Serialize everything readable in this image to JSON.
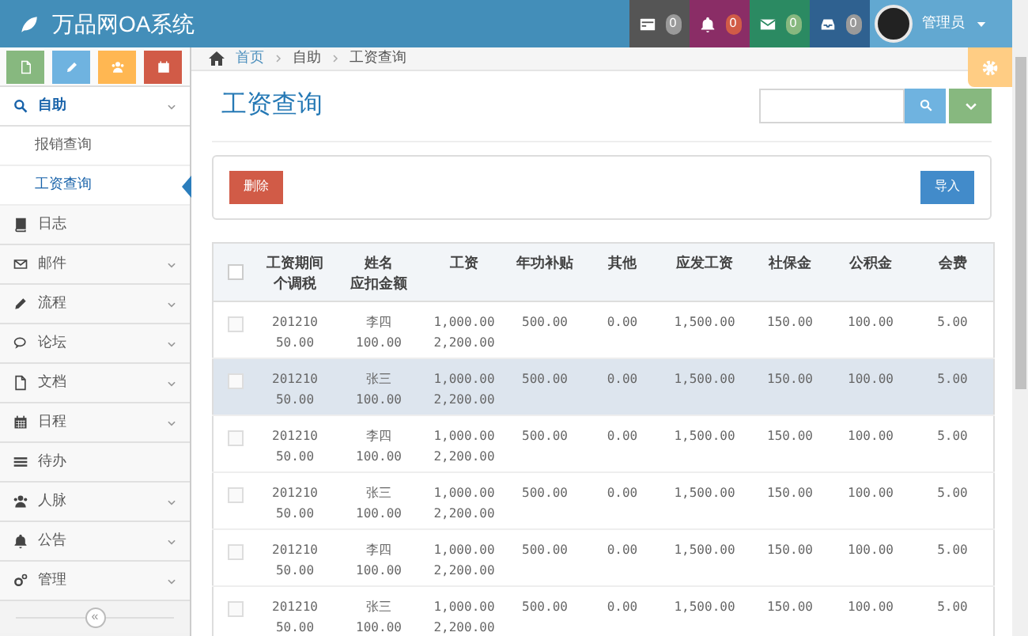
{
  "app_title": "万品网OA系统",
  "nav_badges": [
    {
      "count": "0",
      "color": "#555555"
    },
    {
      "count": "0",
      "color": "#8a2d66"
    },
    {
      "count": "0",
      "color": "#2b8a62"
    },
    {
      "count": "0",
      "color": "#2f6190"
    }
  ],
  "user": {
    "name": "管理员"
  },
  "shortcuts": [
    {
      "color": "#87b87f"
    },
    {
      "color": "#6fb3e0"
    },
    {
      "color": "#ffb752"
    },
    {
      "color": "#d15b47"
    }
  ],
  "breadcrumb": [
    "首页",
    "自助",
    "工资查询"
  ],
  "sidebar": {
    "items": [
      {
        "label": "自助",
        "has_submenu": true,
        "expanded": true,
        "children": [
          {
            "label": "报销查询",
            "selected": false
          },
          {
            "label": "工资查询",
            "selected": true
          }
        ]
      },
      {
        "label": "日志",
        "has_submenu": false,
        "expanded": false
      },
      {
        "label": "邮件",
        "has_submenu": true,
        "expanded": false
      },
      {
        "label": "流程",
        "has_submenu": true,
        "expanded": false
      },
      {
        "label": "论坛",
        "has_submenu": true,
        "expanded": false
      },
      {
        "label": "文档",
        "has_submenu": true,
        "expanded": false
      },
      {
        "label": "日程",
        "has_submenu": true,
        "expanded": false
      },
      {
        "label": "待办",
        "has_submenu": false,
        "expanded": false
      },
      {
        "label": "人脉",
        "has_submenu": true,
        "expanded": false
      },
      {
        "label": "公告",
        "has_submenu": true,
        "expanded": false
      },
      {
        "label": "管理",
        "has_submenu": true,
        "expanded": false
      }
    ],
    "collapse_button": "«"
  },
  "page_title": "工资查询",
  "toolbar": {
    "delete_button": "删除",
    "import_button": "导入"
  },
  "table": {
    "select_all_checked": false,
    "columns": [
      {
        "label": "工资期间",
        "sublabel": "个调税"
      },
      {
        "label": "姓名",
        "sublabel": "应扣金额"
      },
      {
        "label": "工资"
      },
      {
        "label": "年功补贴"
      },
      {
        "label": "其他"
      },
      {
        "label": "应发工资"
      },
      {
        "label": "社保金"
      },
      {
        "label": "公积金"
      },
      {
        "label": "会费"
      }
    ],
    "rows": [
      {
        "checked": false,
        "highlighted": false,
        "cells": [
          "201210\n50.00",
          "李四\n100.00",
          "1,000.00\n2,200.00",
          "500.00",
          "0.00",
          "1,500.00",
          "150.00",
          "100.00",
          "5.00"
        ]
      },
      {
        "checked": false,
        "highlighted": true,
        "cells": [
          "201210\n50.00",
          "张三\n100.00",
          "1,000.00\n2,200.00",
          "500.00",
          "0.00",
          "1,500.00",
          "150.00",
          "100.00",
          "5.00"
        ]
      },
      {
        "checked": false,
        "highlighted": false,
        "cells": [
          "201210\n50.00",
          "李四\n100.00",
          "1,000.00\n2,200.00",
          "500.00",
          "0.00",
          "1,500.00",
          "150.00",
          "100.00",
          "5.00"
        ]
      },
      {
        "checked": false,
        "highlighted": false,
        "cells": [
          "201210\n50.00",
          "张三\n100.00",
          "1,000.00\n2,200.00",
          "500.00",
          "0.00",
          "1,500.00",
          "150.00",
          "100.00",
          "5.00"
        ]
      },
      {
        "checked": false,
        "highlighted": false,
        "cells": [
          "201210\n50.00",
          "李四\n100.00",
          "1,000.00\n2,200.00",
          "500.00",
          "0.00",
          "1,500.00",
          "150.00",
          "100.00",
          "5.00"
        ]
      },
      {
        "checked": false,
        "highlighted": false,
        "cells": [
          "201210\n50.00",
          "张三\n100.00",
          "1,000.00\n2,200.00",
          "500.00",
          "0.00",
          "1,500.00",
          "150.00",
          "100.00",
          "5.00"
        ]
      }
    ]
  }
}
